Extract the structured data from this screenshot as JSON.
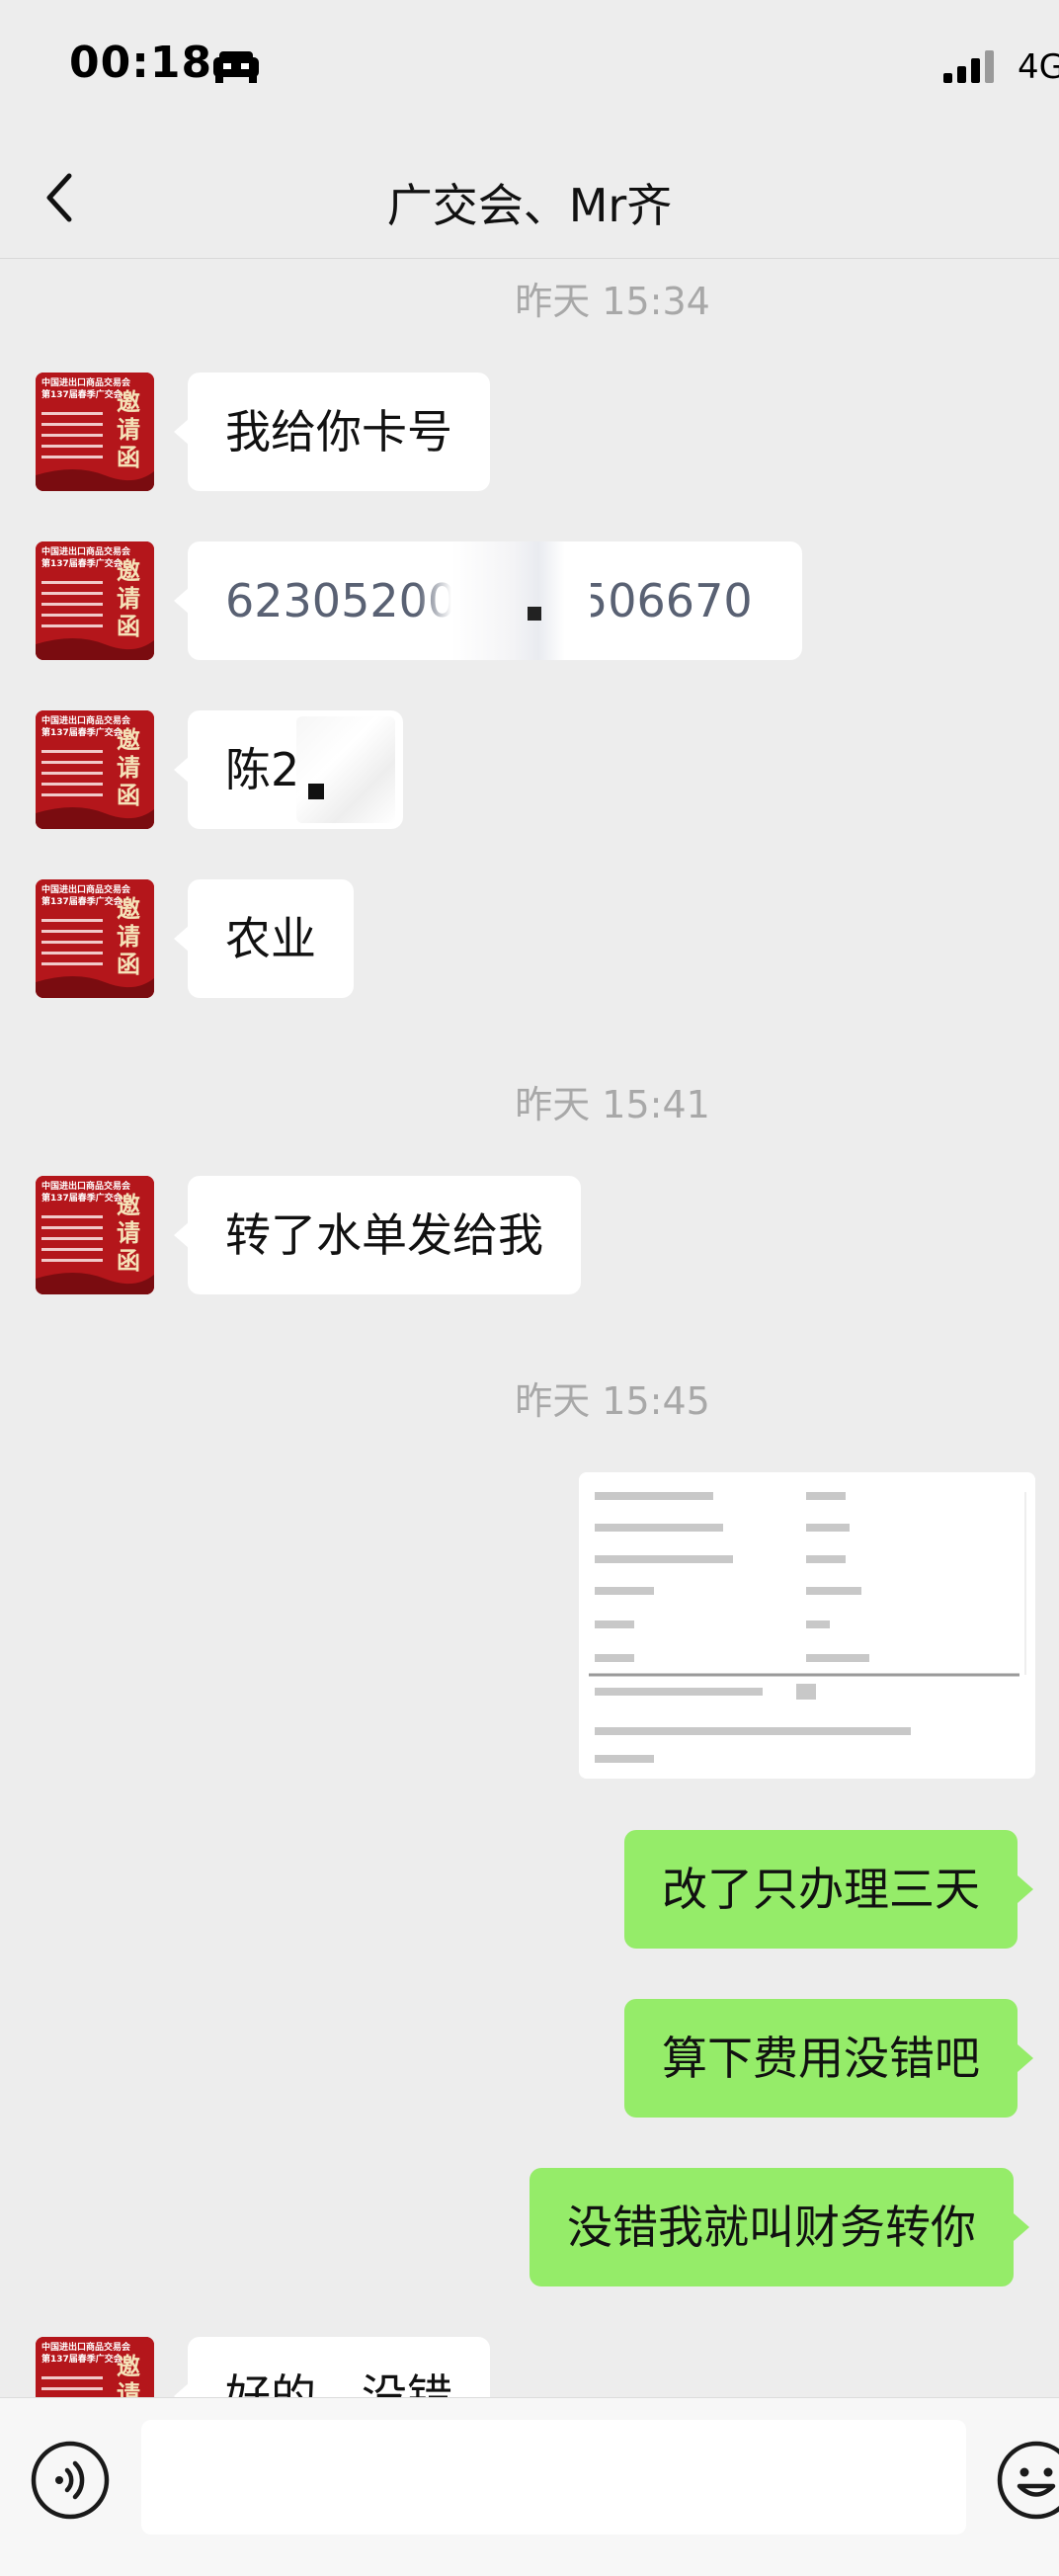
{
  "status_bar": {
    "time": "00:18",
    "network": "4G",
    "icons": [
      "car-icon",
      "signal-icon"
    ]
  },
  "nav": {
    "title": "广交会、Mr齐",
    "back_icon": "chevron-left-icon"
  },
  "timestamps": [
    "昨天 15:34",
    "昨天 15:41",
    "昨天 15:45"
  ],
  "messages": [
    {
      "side": "left",
      "text": "我给你卡号"
    },
    {
      "side": "left",
      "text": "623052008",
      "text_end": "506670"
    },
    {
      "side": "left",
      "text": "陈2"
    },
    {
      "side": "left",
      "text": "农业"
    },
    {
      "side": "left",
      "text": "转了水单发给我"
    },
    {
      "side": "right",
      "type": "image"
    },
    {
      "side": "right",
      "text": "改了只办理三天"
    },
    {
      "side": "right",
      "text": "算下费用没错吧"
    },
    {
      "side": "right",
      "text": "没错我就叫财务转你"
    },
    {
      "side": "left",
      "text": "好的，没错"
    }
  ],
  "avatar": {
    "lines": [
      "中国进出口商品交易会",
      "第137届春季广交会"
    ],
    "stamp": [
      "邀",
      "请",
      "函"
    ]
  },
  "colors": {
    "background": "#ededed",
    "sent_bubble": "#95ec69",
    "received_bubble": "#ffffff",
    "avatar": "#b4161b",
    "timestamp": "#a8a8a8"
  },
  "input_bar": {
    "left_icon": "voice-icon",
    "right_icon": "emoji-icon"
  }
}
